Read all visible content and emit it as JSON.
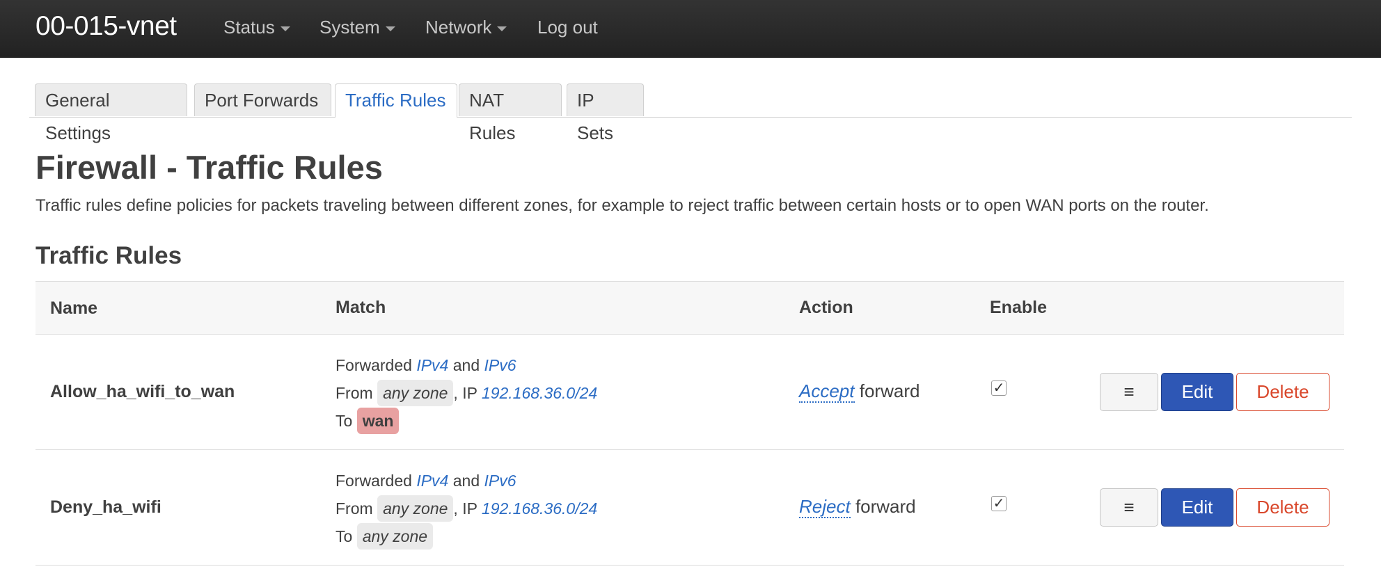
{
  "navbar": {
    "brand": "00-015-vnet",
    "menu": [
      {
        "label": "Status",
        "dropdown": true
      },
      {
        "label": "System",
        "dropdown": true
      },
      {
        "label": "Network",
        "dropdown": true
      },
      {
        "label": "Log out",
        "dropdown": false
      }
    ]
  },
  "tabs": [
    {
      "label": "General Settings",
      "active": false
    },
    {
      "label": "Port Forwards",
      "active": false
    },
    {
      "label": "Traffic Rules",
      "active": true
    },
    {
      "label": "NAT Rules",
      "active": false
    },
    {
      "label": "IP Sets",
      "active": false
    }
  ],
  "page": {
    "title": "Firewall - Traffic Rules",
    "description": "Traffic rules define policies for packets traveling between different zones, for example to reject traffic between certain hosts or to open WAN ports on the router.",
    "section_title": "Traffic Rules"
  },
  "table": {
    "headers": {
      "name": "Name",
      "match": "Match",
      "action": "Action",
      "enable": "Enable"
    },
    "rows": [
      {
        "name": "Allow_ha_wifi_to_wan",
        "match": {
          "forwarded": "Forwarded",
          "ipv4": "IPv4",
          "and": "and",
          "ipv6": "IPv6",
          "from": "From",
          "from_zone": "any zone",
          "ip_label": ", IP",
          "ip": "192.168.36.0/24",
          "to": "To",
          "to_zone": "wan"
        },
        "action": {
          "verb": "Accept",
          "target": "forward"
        },
        "enabled": true,
        "buttons": {
          "menu": "≡",
          "edit": "Edit",
          "delete": "Delete"
        }
      },
      {
        "name": "Deny_ha_wifi",
        "match": {
          "forwarded": "Forwarded",
          "ipv4": "IPv4",
          "and": "and",
          "ipv6": "IPv6",
          "from": "From",
          "from_zone": "any zone",
          "ip_label": ", IP",
          "ip": "192.168.36.0/24",
          "to": "To",
          "to_zone": "any zone"
        },
        "action": {
          "verb": "Reject",
          "target": "forward"
        },
        "enabled": true,
        "buttons": {
          "menu": "≡",
          "edit": "Edit",
          "delete": "Delete"
        }
      }
    ]
  },
  "colors": {
    "accent": "#2b6cc4",
    "navbar": "#222222",
    "edit_button": "#2e57b5",
    "delete_button": "#d9472b",
    "wan_zone": "#e8a1a1",
    "zone_badge": "#eaeaea"
  }
}
